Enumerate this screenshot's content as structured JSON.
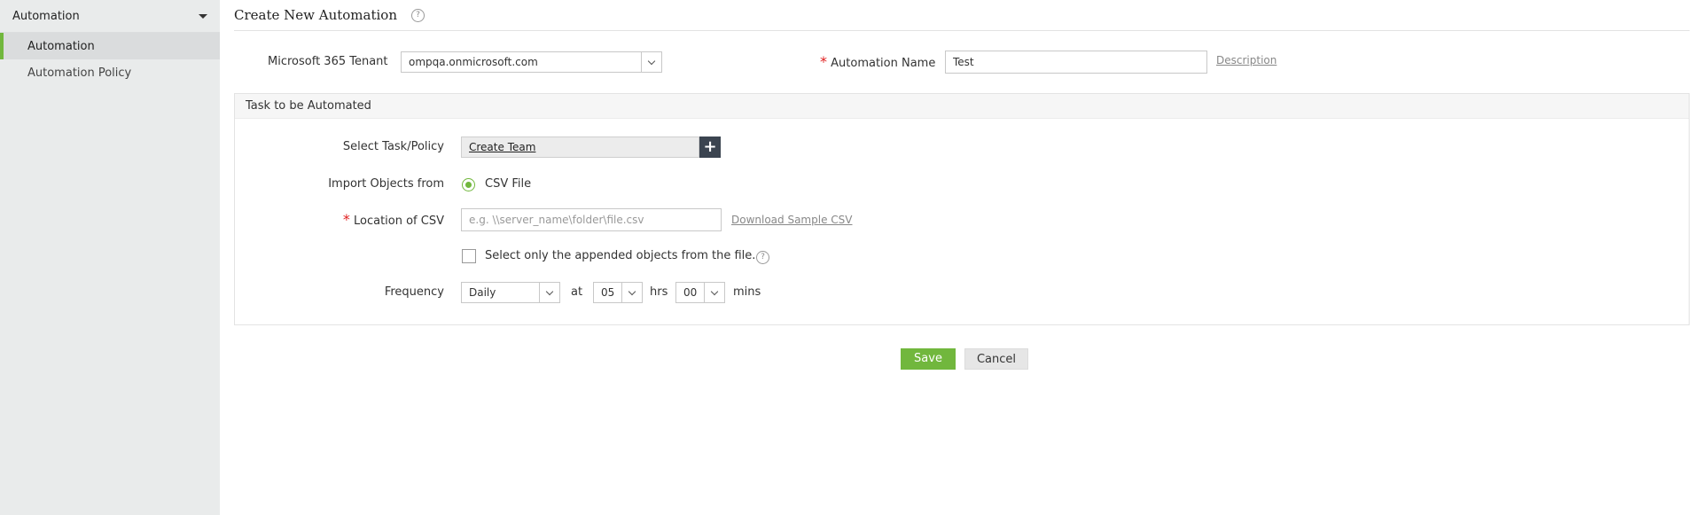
{
  "sidebar": {
    "header": "Automation",
    "items": [
      {
        "label": "Automation",
        "active": true
      },
      {
        "label": "Automation Policy",
        "active": false
      }
    ]
  },
  "page": {
    "title": "Create New Automation",
    "help_icon": "?"
  },
  "form": {
    "tenant_label": "Microsoft 365 Tenant",
    "tenant_value": "ompqa.onmicrosoft.com",
    "name_required": "*",
    "name_label": "Automation Name",
    "name_value": "Test",
    "description_link": "Description",
    "task_section_title": "Task to be Automated",
    "task_label": "Select Task/Policy",
    "task_value": "Create Team",
    "task_add": "+",
    "import_label": "Import Objects from",
    "import_option": "CSV File",
    "csv_required": "*",
    "csv_label": "Location of CSV",
    "csv_placeholder": "e.g. \\\\server_name\\folder\\file.csv",
    "csv_sample_link": "Download Sample CSV",
    "appended_label": "Select only the appended objects from the file.",
    "frequency_label": "Frequency",
    "frequency_value": "Daily",
    "at_label": "at",
    "hours_value": "05",
    "hrs_label": "hrs",
    "minutes_value": "00",
    "mins_label": "mins"
  },
  "actions": {
    "save": "Save",
    "cancel": "Cancel"
  },
  "colors": {
    "accent": "#71b73d",
    "sidebar_bg": "#e9ebeb",
    "required": "#e02020",
    "dark_button": "#3b4450"
  }
}
